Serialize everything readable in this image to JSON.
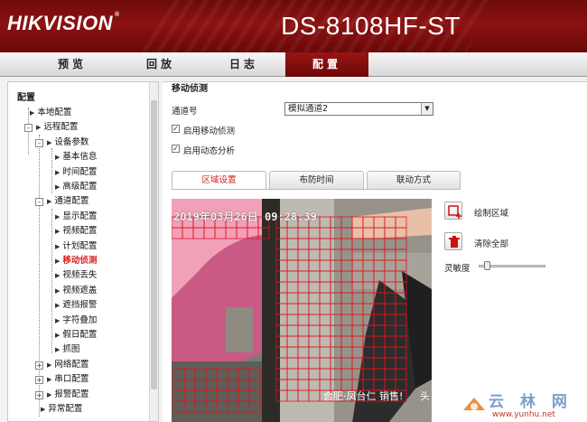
{
  "header": {
    "brand": "HIKVISION",
    "model": "DS-8108HF-ST"
  },
  "nav": {
    "tabs": [
      "预览",
      "回放",
      "日志",
      "配置"
    ],
    "active": "配置"
  },
  "sidebar": {
    "title": "配置",
    "items": [
      {
        "label": "本地配置",
        "level": 1,
        "toggle": ""
      },
      {
        "label": "远程配置",
        "level": 1,
        "toggle": "-"
      },
      {
        "label": "设备参数",
        "level": 2,
        "toggle": "-"
      },
      {
        "label": "基本信息",
        "level": 3,
        "toggle": ""
      },
      {
        "label": "时间配置",
        "level": 3,
        "toggle": ""
      },
      {
        "label": "高级配置",
        "level": 3,
        "toggle": ""
      },
      {
        "label": "通道配置",
        "level": 2,
        "toggle": "-"
      },
      {
        "label": "显示配置",
        "level": 3,
        "toggle": ""
      },
      {
        "label": "视频配置",
        "level": 3,
        "toggle": ""
      },
      {
        "label": "计划配置",
        "level": 3,
        "toggle": ""
      },
      {
        "label": "移动侦测",
        "level": 3,
        "toggle": "",
        "active": true
      },
      {
        "label": "视频丢失",
        "level": 3,
        "toggle": ""
      },
      {
        "label": "视频遮盖",
        "level": 3,
        "toggle": ""
      },
      {
        "label": "遮挡报警",
        "level": 3,
        "toggle": ""
      },
      {
        "label": "字符叠加",
        "level": 3,
        "toggle": ""
      },
      {
        "label": "假日配置",
        "level": 3,
        "toggle": ""
      },
      {
        "label": "抓图",
        "level": 3,
        "toggle": ""
      },
      {
        "label": "网络配置",
        "level": 2,
        "toggle": "+"
      },
      {
        "label": "串口配置",
        "level": 2,
        "toggle": "+"
      },
      {
        "label": "报警配置",
        "level": 2,
        "toggle": "+"
      },
      {
        "label": "异常配置",
        "level": 2,
        "toggle": ""
      }
    ]
  },
  "main": {
    "section_title": "移动侦测",
    "channel_label": "通道号",
    "channel_value": "模拟通道2",
    "enable_motion": {
      "label": "启用移动侦测",
      "checked": true
    },
    "enable_dynamic": {
      "label": "启用动态分析",
      "checked": true
    },
    "tabs": [
      "区域设置",
      "布防时间",
      "联动方式"
    ],
    "active_tab": "区域设置",
    "video": {
      "timestamp": "2019年03月26日 09:28:39",
      "overlay_text": "合肥·凤台仁 销售!",
      "overlay_text2": "头"
    },
    "actions": {
      "draw_area": "绘制区域",
      "clear_all": "清除全部",
      "sensitivity": "灵敏度"
    },
    "sensitivity_level": 0.1
  },
  "watermark": {
    "text": "云 林 网",
    "url": "www.yunhu.net"
  }
}
